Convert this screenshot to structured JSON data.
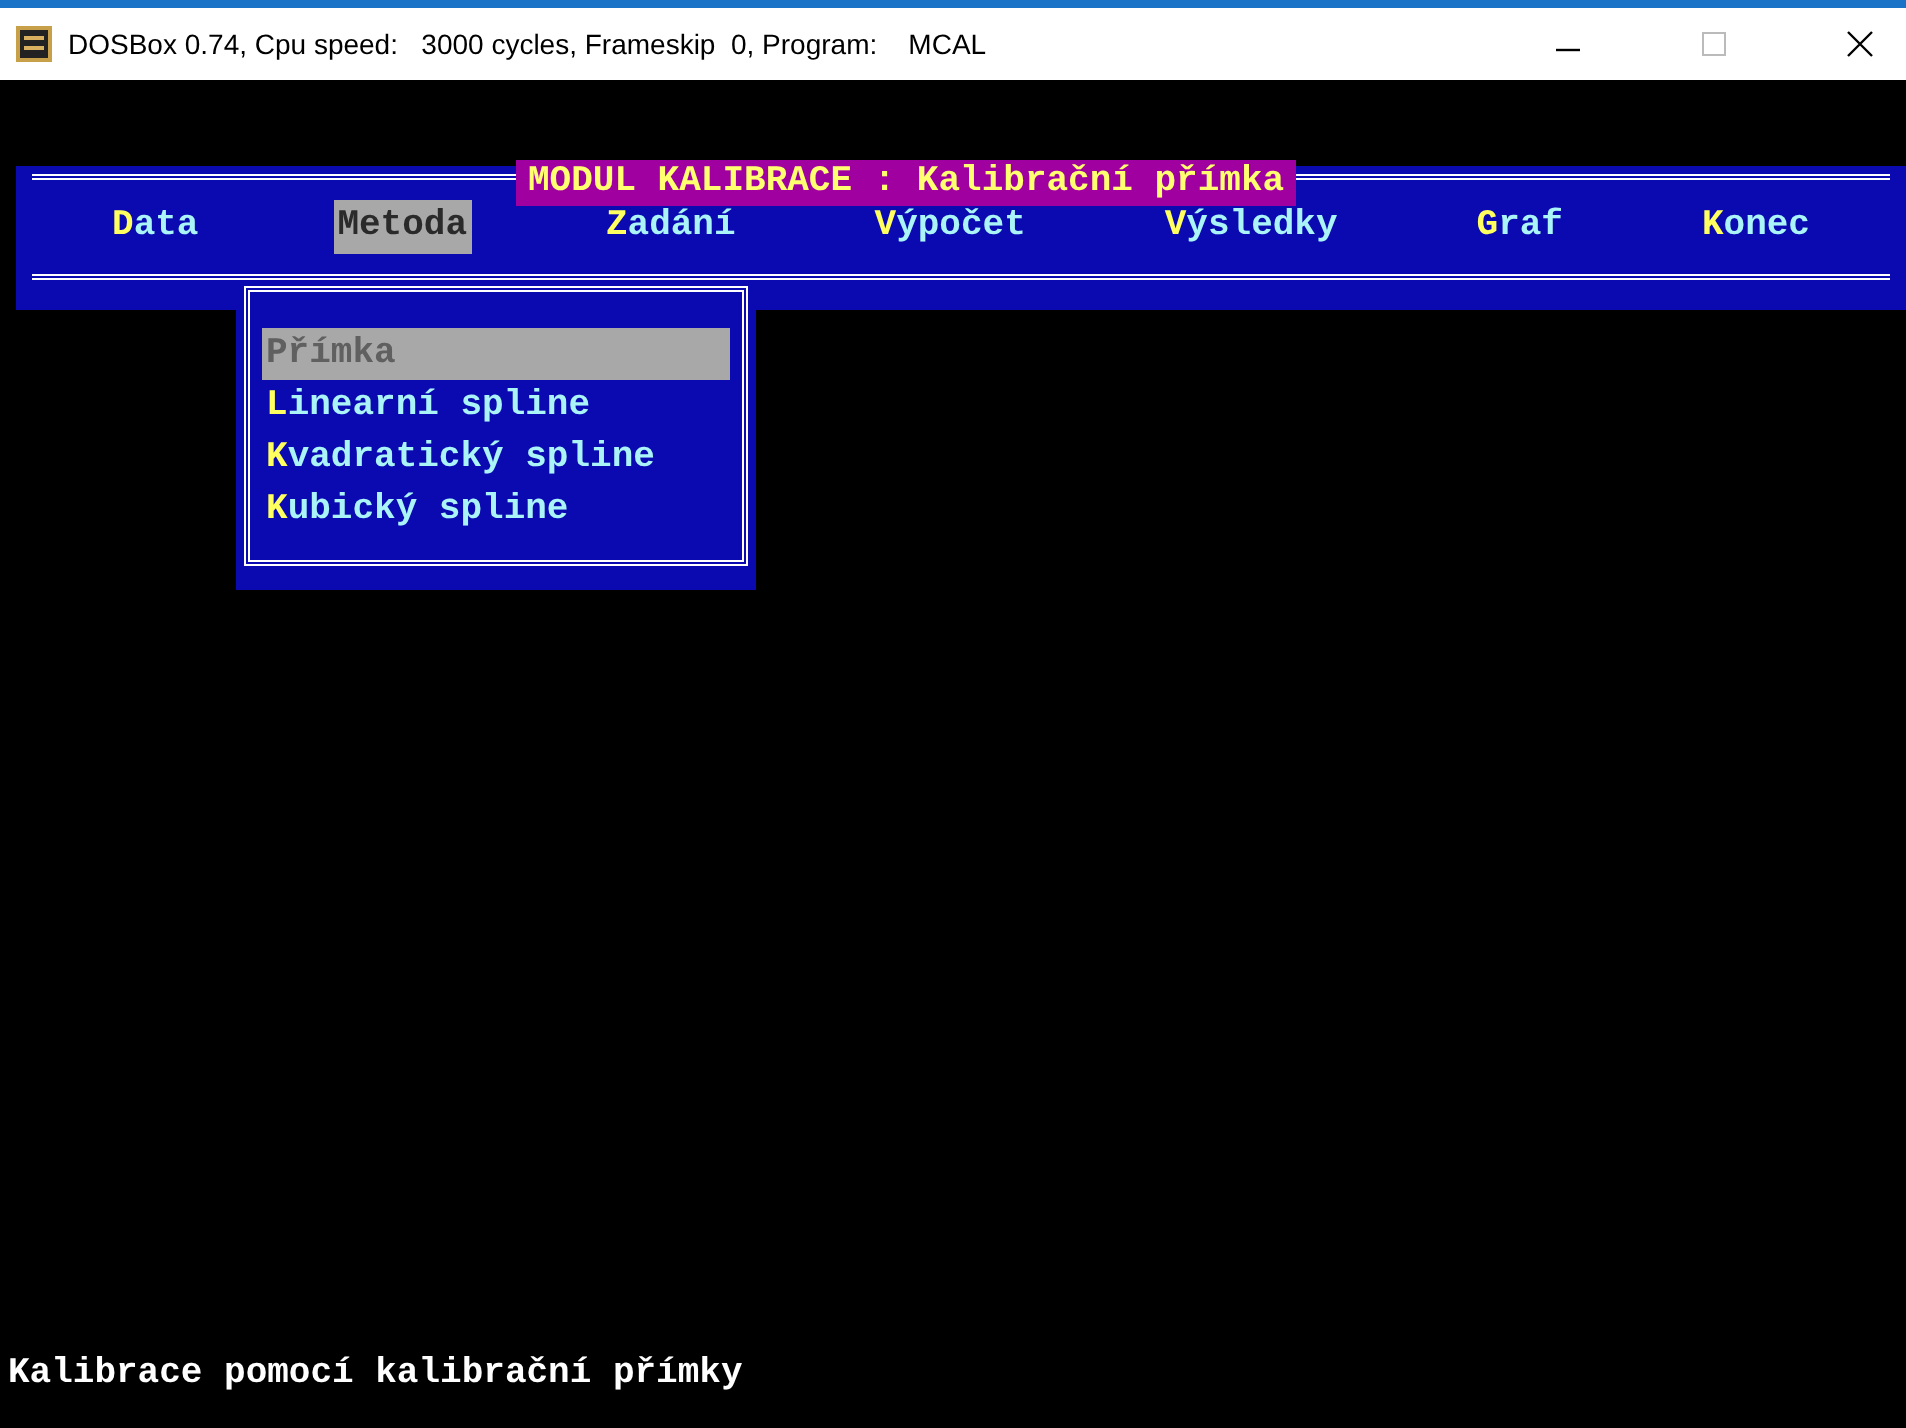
{
  "window": {
    "title": "DOSBox 0.74, Cpu speed:   3000 cycles, Frameskip  0, Program:    MCAL"
  },
  "module_title": "MODUL KALIBRACE : Kalibrační přímka",
  "menu_bar": [
    {
      "label": "Data",
      "selected": false
    },
    {
      "label": "Metoda",
      "selected": true
    },
    {
      "label": "Zadání",
      "selected": false
    },
    {
      "label": "Výpočet",
      "selected": false
    },
    {
      "label": "Výsledky",
      "selected": false
    },
    {
      "label": "Graf",
      "selected": false
    },
    {
      "label": "Konec",
      "selected": false
    }
  ],
  "dropdown": [
    {
      "label": "Přímka",
      "selected": true
    },
    {
      "label": "Linearní spline",
      "selected": false
    },
    {
      "label": "Kvadratický spline",
      "selected": false
    },
    {
      "label": "Kubický spline",
      "selected": false
    }
  ],
  "status_line": "Kalibrace pomocí kalibrační přímky"
}
